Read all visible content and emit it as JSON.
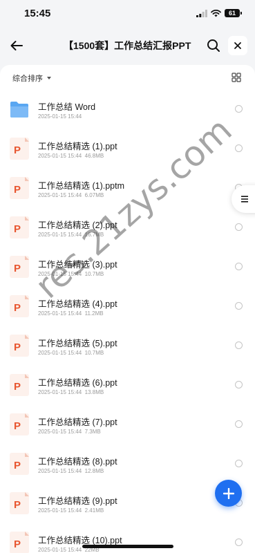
{
  "status_bar": {
    "time": "15:45",
    "battery": "61"
  },
  "header": {
    "title": "【1500套】工作总结汇报PPT"
  },
  "toolbar": {
    "sort_label": "综合排序"
  },
  "files": [
    {
      "name": "工作总结 Word",
      "date": "2025-01-15 15:44",
      "size": "",
      "type": "folder"
    },
    {
      "name": "工作总结精选 (1).ppt",
      "date": "2025-01-15 15:44",
      "size": "46.8MB",
      "type": "ppt"
    },
    {
      "name": "工作总结精选 (1).pptm",
      "date": "2025-01-15 15:44",
      "size": "6.07MB",
      "type": "ppt"
    },
    {
      "name": "工作总结精选 (2).ppt",
      "date": "2025-01-15 15:44",
      "size": "16.7MB",
      "type": "ppt"
    },
    {
      "name": "工作总结精选 (3).ppt",
      "date": "2025-01-15 15:44",
      "size": "10.7MB",
      "type": "ppt"
    },
    {
      "name": "工作总结精选 (4).ppt",
      "date": "2025-01-15 15:44",
      "size": "11.2MB",
      "type": "ppt"
    },
    {
      "name": "工作总结精选 (5).ppt",
      "date": "2025-01-15 15:44",
      "size": "10.7MB",
      "type": "ppt"
    },
    {
      "name": "工作总结精选 (6).ppt",
      "date": "2025-01-15 15:44",
      "size": "13.8MB",
      "type": "ppt"
    },
    {
      "name": "工作总结精选 (7).ppt",
      "date": "2025-01-15 15:44",
      "size": "7.3MB",
      "type": "ppt"
    },
    {
      "name": "工作总结精选 (8).ppt",
      "date": "2025-01-15 15:44",
      "size": "12.8MB",
      "type": "ppt"
    },
    {
      "name": "工作总结精选 (9).ppt",
      "date": "2025-01-15 15:44",
      "size": "2.41MB",
      "type": "ppt"
    },
    {
      "name": "工作总结精选 (10).ppt",
      "date": "2025-01-15 15:44",
      "size": "22MB",
      "type": "ppt"
    }
  ],
  "watermark": "res.21zys.com",
  "colors": {
    "accent": "#1f6ff0",
    "ppt_icon": "#e8552f",
    "folder": "#5aa7f2"
  },
  "icons": {
    "back": "arrow-left-icon",
    "search": "search-icon",
    "close": "close-icon",
    "grid": "grid-view-icon",
    "menu": "menu-icon",
    "add": "plus-icon"
  }
}
